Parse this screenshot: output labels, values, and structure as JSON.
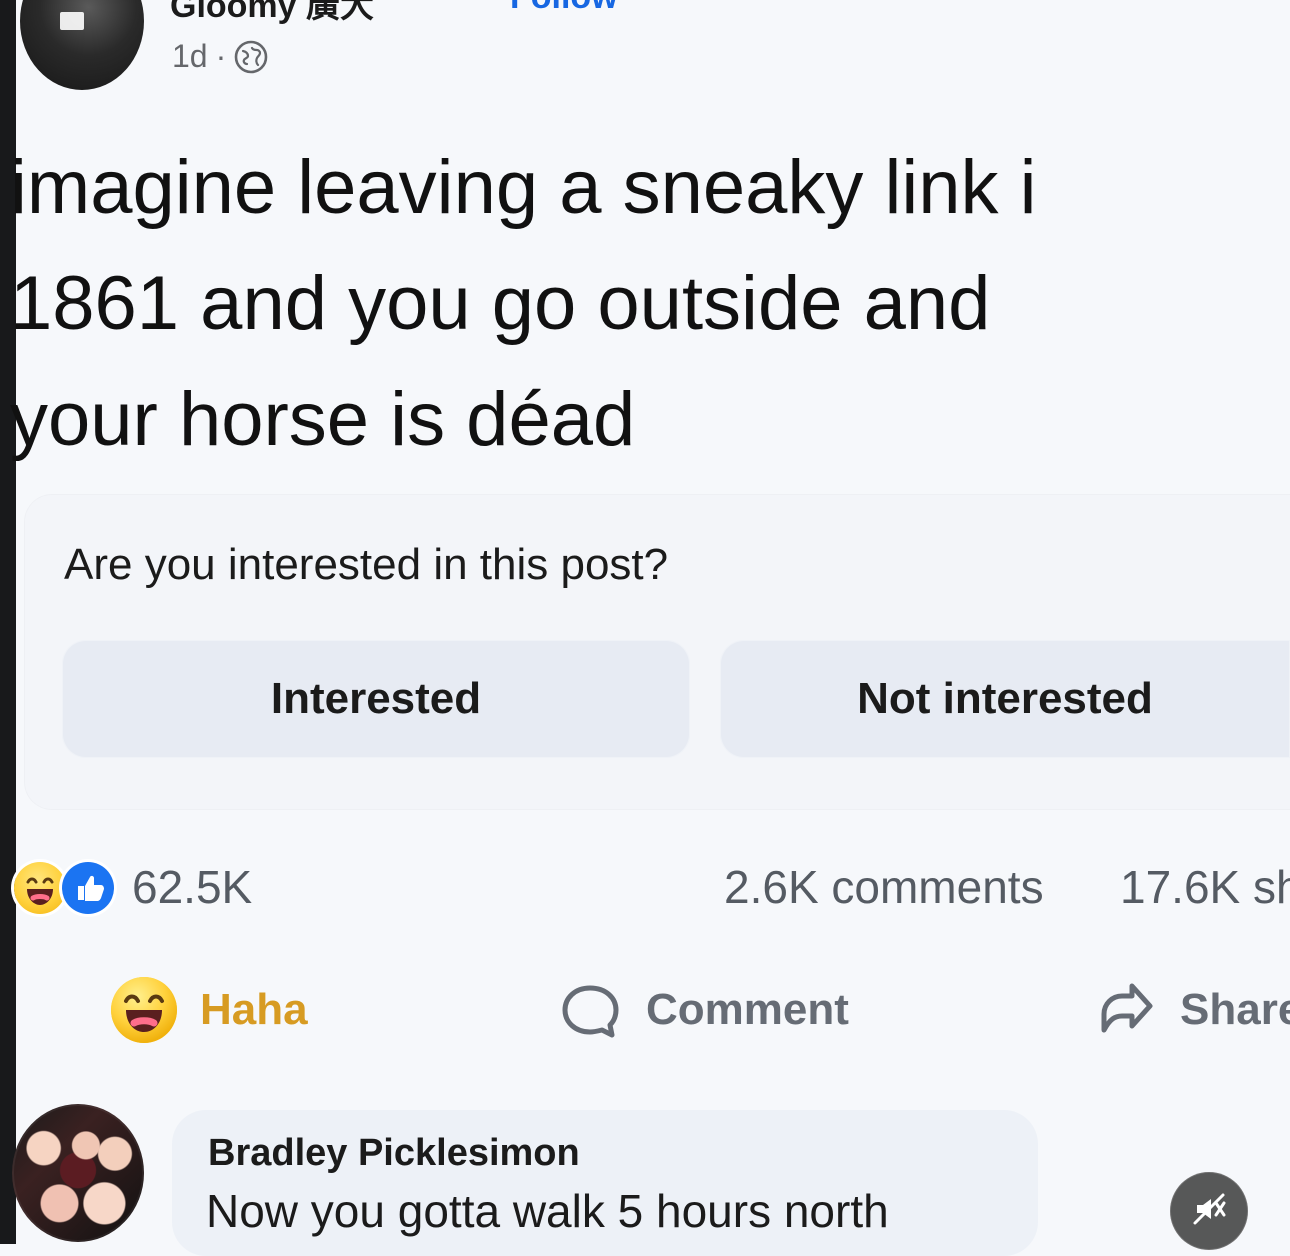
{
  "post_header": {
    "author_name": "Gloomy 廣大",
    "follow_label": "Follow",
    "time": "1d",
    "separator": "·",
    "privacy_icon": "globe-icon"
  },
  "post": {
    "lines": [
      "imagine leaving a sneaky link i",
      "1861 and you go outside and",
      "your horse is déad"
    ]
  },
  "interest_prompt": {
    "question": "Are you interested in this post?",
    "interested_label": "Interested",
    "not_interested_label": "Not interested"
  },
  "engagement": {
    "reaction_count": "62.5K",
    "comments_count": "2.6K comments",
    "shares_count": "17.6K sh",
    "reaction_icons": [
      "haha-icon",
      "like-icon"
    ]
  },
  "actions": {
    "haha_label": "Haha",
    "comment_label": "Comment",
    "share_label": "Share"
  },
  "comment": {
    "name": "Bradley Picklesimon",
    "text": "Now you gotta walk 5 hours north"
  },
  "media_controls": {
    "mute_icon": "mute-icon"
  },
  "colors": {
    "background": "#f6f8fb",
    "link_blue": "#1767e2",
    "haha_gold": "#d79b22",
    "muted_text": "#666c75",
    "card_bg": "#f3f5f9",
    "button_bg": "#e7ebf3",
    "comment_bubble_bg": "#edf1f7"
  }
}
